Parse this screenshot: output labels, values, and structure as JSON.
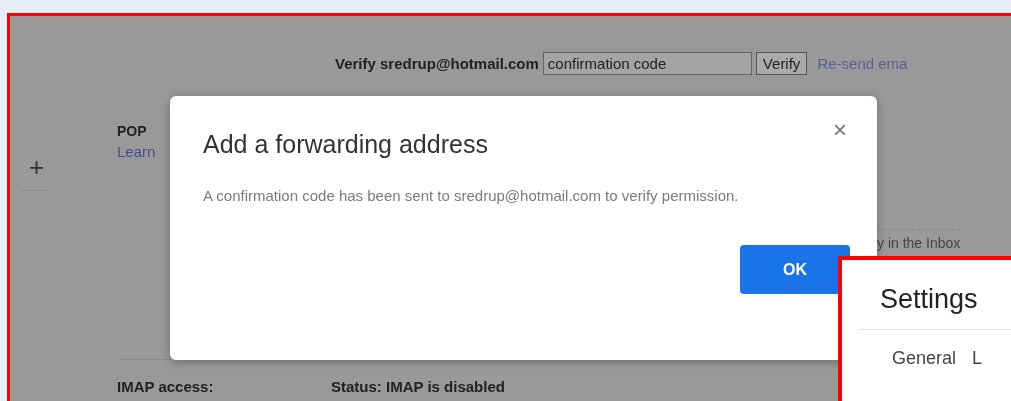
{
  "verify_row": {
    "label": "Verify sredrup@hotmail.com",
    "code_field": {
      "value": "confirmation code"
    },
    "verify_button": "Verify",
    "resend_link": "Re-send ema"
  },
  "pop": {
    "label": "POP",
    "link": "Learn"
  },
  "add_icon": "+",
  "inbox_note": "y in the Inbox",
  "imap": {
    "label": "IMAP access:",
    "status": "Status: IMAP is disabled"
  },
  "dialog": {
    "title": "Add a forwarding address",
    "message": "A confirmation code has been sent to sredrup@hotmail.com to verify permission.",
    "close": "×",
    "ok_button": "OK"
  },
  "settings_panel": {
    "title": "Settings",
    "tabs": [
      {
        "label": "General",
        "selected": false
      },
      {
        "label": "L",
        "selected": false
      }
    ]
  }
}
